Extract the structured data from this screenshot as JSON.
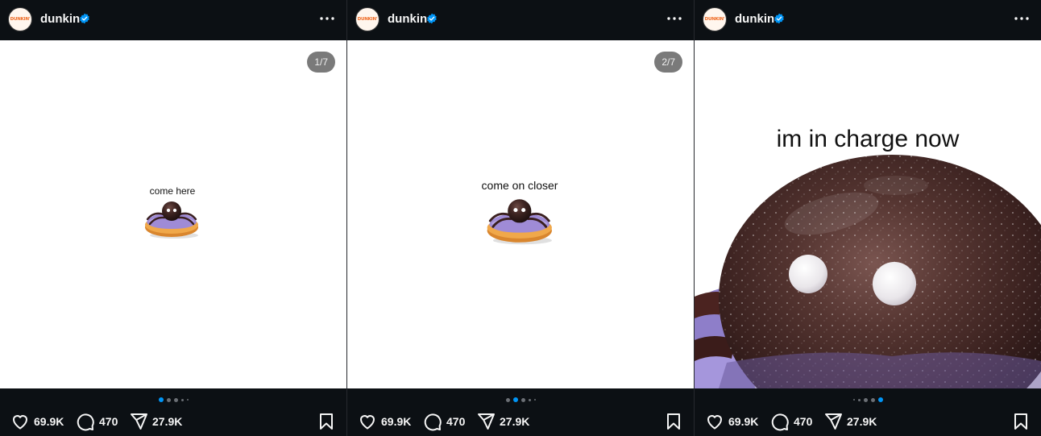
{
  "account": {
    "username": "dunkin",
    "avatar_text": "DUNKIN'",
    "verified_icon": "verified-badge-icon",
    "brand_colors": {
      "orange": "#ef6a23",
      "pink": "#e11383",
      "verified": "#0095f6"
    }
  },
  "posts": [
    {
      "counter": "1/7",
      "caption": "come here",
      "active_slide": 1,
      "likes": "69.9K",
      "comments": "470",
      "shares": "27.9K"
    },
    {
      "counter": "2/7",
      "caption": "come on closer",
      "active_slide": 2,
      "likes": "69.9K",
      "comments": "470",
      "shares": "27.9K"
    },
    {
      "counter": "",
      "caption": "im in charge now",
      "active_slide": 7,
      "likes": "69.9K",
      "comments": "470",
      "shares": "27.9K"
    }
  ],
  "icons": {
    "like": "heart-icon",
    "comment": "comment-bubble-icon",
    "share": "paper-plane-icon",
    "save": "bookmark-icon",
    "more": "more-options-icon"
  }
}
